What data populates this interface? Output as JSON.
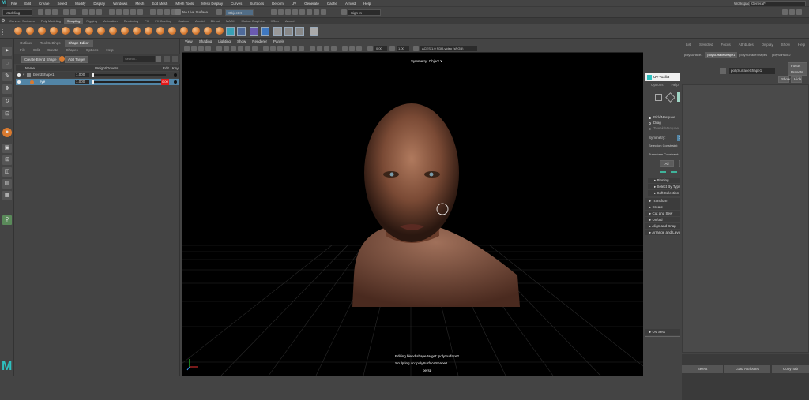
{
  "menubar": {
    "items": [
      "File",
      "Edit",
      "Create",
      "Select",
      "Modify",
      "Display",
      "Windows",
      "Mesh",
      "Edit Mesh",
      "Mesh Tools",
      "Mesh Display",
      "Curves",
      "Surfaces",
      "Deform",
      "UV",
      "Generate",
      "Cache",
      "Arnold",
      "Help"
    ],
    "workspace_label": "Workspace:",
    "workspace_value": "General*"
  },
  "statusline": {
    "mode": "Modeling",
    "live_surface": "No Live Surface",
    "object_field": "Object X",
    "sign_in": "Sign In"
  },
  "shelf": {
    "tabs": [
      "Curves / Surfaces",
      "Poly Modeling",
      "Sculpting",
      "Rigging",
      "Animation",
      "Rendering",
      "FX",
      "FX Caching",
      "Custom",
      "Arnold",
      "Bifrost",
      "MASH",
      "Motion Graphics",
      "XGen",
      "Arnold"
    ],
    "active": "Sculpting"
  },
  "shape_editor": {
    "tabs": [
      "Outliner",
      "Tool Settings",
      "Shape Editor"
    ],
    "active_tab": "Shape Editor",
    "menu": [
      "File",
      "Edit",
      "Create",
      "Shapes",
      "Options",
      "Help"
    ],
    "create_blend_shape": "Create Blend Shape",
    "add_target": "Add Target",
    "search_placeholder": "Search...",
    "col_name": "Name",
    "col_weight": "Weight/Drivers",
    "col_edit": "Edit",
    "col_key": "Key",
    "rows": [
      {
        "name": "blendShape1",
        "value": "1.000",
        "weight": 1.0
      },
      {
        "name": "eye",
        "value": "1.000",
        "weight": 1.0,
        "edit_value": "0.00"
      }
    ]
  },
  "viewport": {
    "menu": [
      "View",
      "Shading",
      "Lighting",
      "Show",
      "Renderer",
      "Panels"
    ],
    "symmetry": "Symmetry: Object X",
    "hud_line1": "Editing blend shape target: polySurface2",
    "hud_line2": "Sculpting on: polySurfaceShape1",
    "camera": "persp",
    "num1": "0.00",
    "num2": "1.00",
    "colorspace": "ACES 1.0 SDR-video (sRGB)"
  },
  "uv_toolkit": {
    "title": "UV Toolkit",
    "menu": [
      "Options",
      "Help"
    ],
    "objects_selected": "1 object selected",
    "pick_marquee": "Pick/Marquee",
    "drag": "Drag",
    "tweak_marquee": "Tweak/Marquee",
    "symmetry_label": "Symmetry:",
    "symmetry_value": "Object X",
    "selection_constraint_label": "Selection Constraint:",
    "selection_constraint_value": "Off",
    "transform_constraint_label": "Transform Constraint:",
    "transform_constraint_value": "Off",
    "all": "All",
    "clear": "Clear",
    "invert": "Invert",
    "sub_sections": [
      "Pinning",
      "Select By Type",
      "Soft Selection"
    ],
    "sections": [
      "Transform",
      "Create",
      "Cut and Sew",
      "Unfold",
      "Align and Snap",
      "Arrange and Layout"
    ],
    "uv_sets": "UV Sets"
  },
  "channel_box": {
    "menu": [
      "List",
      "Selected",
      "Focus",
      "Attributes",
      "Display",
      "Show",
      "Help"
    ],
    "tabs": [
      "polySurface1",
      "polySurfaceShape1",
      "polySurfaceShape1",
      "polySurface2"
    ],
    "node_name": "polySurfaceShape1",
    "focus": "Focus",
    "presets": "Presets",
    "show": "Show",
    "hide": "Hide"
  },
  "bottom": {
    "select": "Select",
    "load_attributes": "Load Attributes",
    "copy_tab": "Copy Tab"
  },
  "colors": {
    "accent": "#5285a6",
    "red": "#e21a1a",
    "bg": "#444444"
  }
}
